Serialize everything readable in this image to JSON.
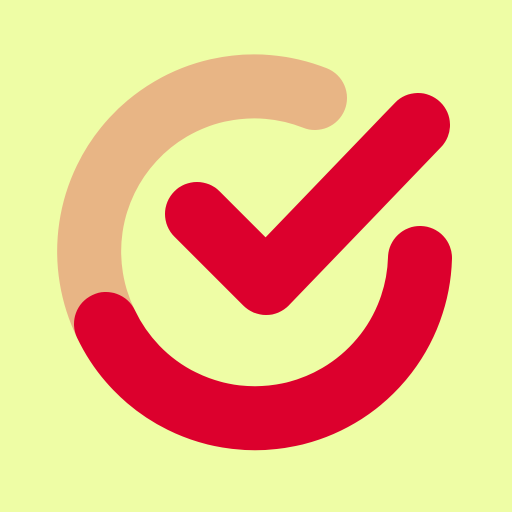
{
  "icon": {
    "name": "checkmark-ring-icon",
    "colors": {
      "background": "#eefda5",
      "ring_light": "#e8b585",
      "ring_dark": "#dc002d",
      "check": "#dc002d"
    }
  }
}
